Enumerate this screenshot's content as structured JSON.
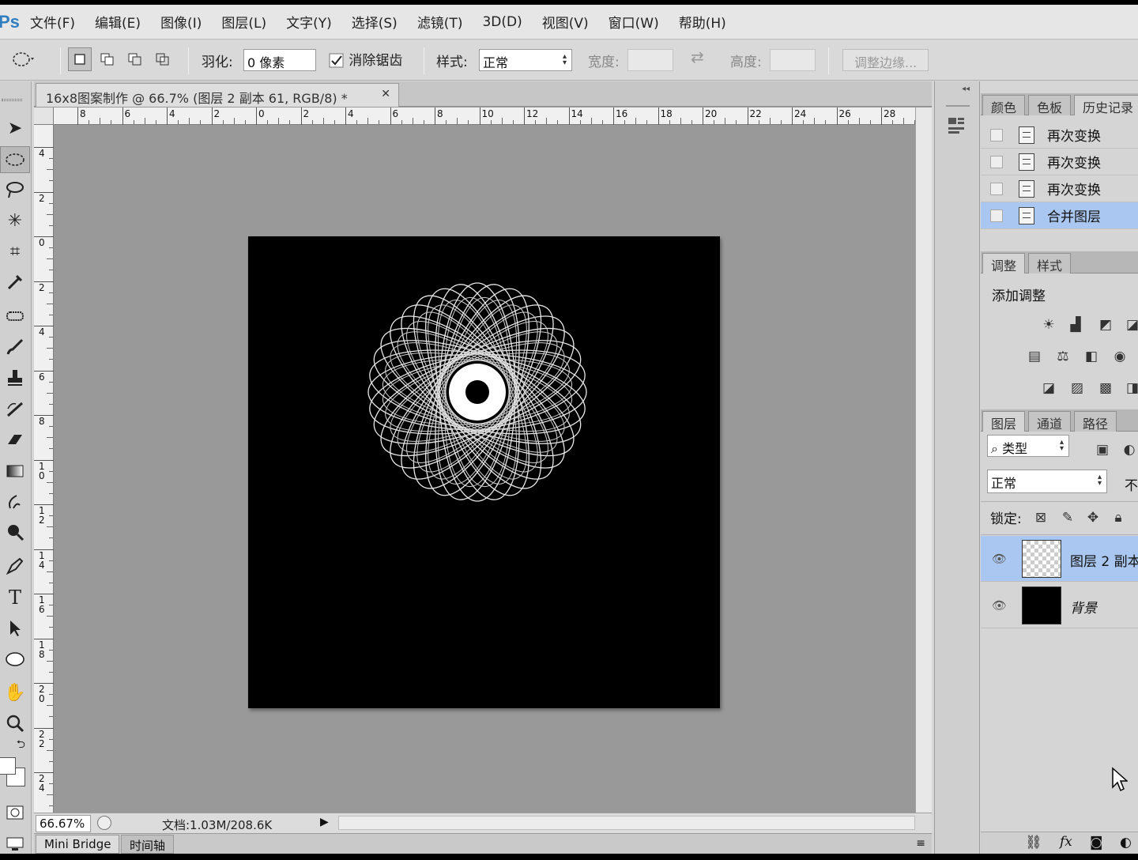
{
  "app": {
    "logo": "Ps"
  },
  "menu": [
    "文件(F)",
    "编辑(E)",
    "图像(I)",
    "图层(L)",
    "文字(Y)",
    "选择(S)",
    "滤镜(T)",
    "3D(D)",
    "视图(V)",
    "窗口(W)",
    "帮助(H)"
  ],
  "options": {
    "feather_label": "羽化:",
    "feather_value": "0 像素",
    "antialias_label": "消除锯齿",
    "antialias_checked": true,
    "style_label": "样式:",
    "style_value": "正常",
    "width_label": "宽度:",
    "height_label": "高度:",
    "refine_edge": "调整边缘..."
  },
  "document": {
    "tab_title": "16x8图案制作 @ 66.7% (图层 2 副本 61, RGB/8) *",
    "zoom": "66.67%",
    "doc_size": "文档:1.03M/208.6K",
    "h_ruler_labels": [
      "8",
      "6",
      "4",
      "2",
      "0",
      "2",
      "4",
      "6",
      "8",
      "10",
      "12",
      "14",
      "16",
      "18",
      "20",
      "22",
      "24",
      "26",
      "28"
    ],
    "v_ruler_labels": [
      "4",
      "2",
      "0",
      "2",
      "4",
      "6",
      "8",
      "1\n0",
      "1\n2",
      "1\n4",
      "1\n6",
      "1\n8",
      "2\n0",
      "2\n2",
      "2\n4"
    ],
    "canvas_color": "#000000",
    "artwork": "white spirograph flower"
  },
  "bottom_tabs": [
    "Mini Bridge",
    "时间轴"
  ],
  "panels": {
    "top_tabs": [
      "颜色",
      "色板",
      "历史记录"
    ],
    "history": [
      {
        "label": "再次变换",
        "selected": false
      },
      {
        "label": "再次变换",
        "selected": false
      },
      {
        "label": "再次变换",
        "selected": false
      },
      {
        "label": "合并图层",
        "selected": true
      }
    ],
    "adjust_tabs": [
      "调整",
      "样式"
    ],
    "adjust_title": "添加调整",
    "layers_tabs": [
      "图层",
      "通道",
      "路径"
    ],
    "filter_kind": "类型",
    "blend_mode": "正常",
    "opacity_label_partial": "不",
    "lock_label": "锁定:",
    "layers": [
      {
        "name": "图层 2 副本",
        "thumb": "transparent",
        "selected": true
      },
      {
        "name": "背景",
        "thumb": "black",
        "selected": false
      }
    ]
  },
  "colors": {
    "selection": "#a9c7f0",
    "ps_blue": "#2f7ec2",
    "workspace": "#999999"
  }
}
